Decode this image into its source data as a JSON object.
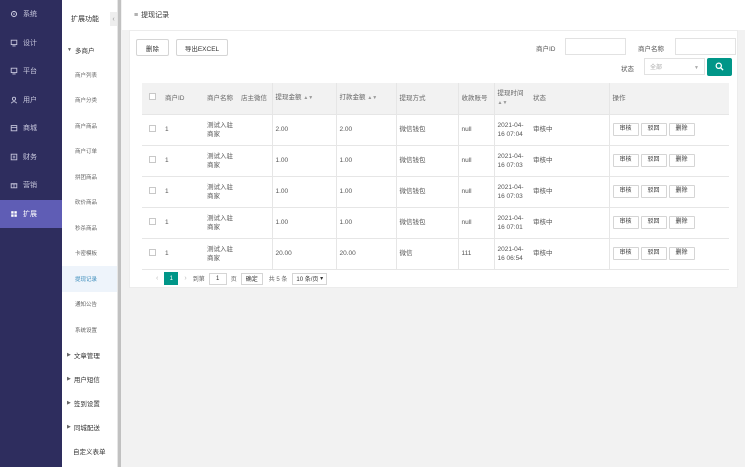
{
  "nav1": {
    "items": [
      {
        "label": "系统",
        "icon": "gear-icon"
      },
      {
        "label": "设计",
        "icon": "monitor-icon"
      },
      {
        "label": "平台",
        "icon": "monitor-icon"
      },
      {
        "label": "用户",
        "icon": "user-icon"
      },
      {
        "label": "商城",
        "icon": "store-icon"
      },
      {
        "label": "财务",
        "icon": "finance-icon"
      },
      {
        "label": "营销",
        "icon": "gift-icon"
      },
      {
        "label": "扩展",
        "icon": "grid-icon"
      }
    ],
    "active_index": 7,
    "active_color": "#5f5db5",
    "bg_color": "#2e2d5e"
  },
  "nav2": {
    "header": "扩展功能",
    "group_multi": "多商户",
    "sub_items": [
      "商户列表",
      "商户分类",
      "商户商品",
      "商户订单",
      "拼团商品",
      "砍价商品",
      "秒杀商品",
      "卡密模板",
      "提现记录",
      "通知公告",
      "系统设置"
    ],
    "active_sub": "提现记录",
    "groups_after": [
      "文章管理",
      "用户短信",
      "签到设置",
      "同城配送"
    ],
    "last_item": "自定义表单"
  },
  "tab": {
    "title": "提现记录"
  },
  "toolbar": {
    "delete_label": "删除",
    "export_label": "导出EXCEL",
    "merchant_id_label": "商户ID",
    "merchant_name_label": "商户名称",
    "status_label": "状态",
    "status_value": "全部",
    "accent": "#009688"
  },
  "table": {
    "headers": [
      "商户ID",
      "商户名称",
      "店主微信",
      "提现金额",
      "打款金额",
      "提现方式",
      "收款账号",
      "提现时间",
      "状态",
      "操作"
    ],
    "rows": [
      {
        "id": "1",
        "name": "测试入驻商家",
        "wx": "",
        "amount": "2.00",
        "paid": "2.00",
        "method": "微信钱包",
        "account": "null",
        "time": "2021-04-16 07:04",
        "status": "审核中"
      },
      {
        "id": "1",
        "name": "测试入驻商家",
        "wx": "",
        "amount": "1.00",
        "paid": "1.00",
        "method": "微信钱包",
        "account": "null",
        "time": "2021-04-16 07:03",
        "status": "审核中"
      },
      {
        "id": "1",
        "name": "测试入驻商家",
        "wx": "",
        "amount": "1.00",
        "paid": "1.00",
        "method": "微信钱包",
        "account": "null",
        "time": "2021-04-16 07:03",
        "status": "审核中"
      },
      {
        "id": "1",
        "name": "测试入驻商家",
        "wx": "",
        "amount": "1.00",
        "paid": "1.00",
        "method": "微信钱包",
        "account": "null",
        "time": "2021-04-16 07:01",
        "status": "审核中"
      },
      {
        "id": "1",
        "name": "测试入驻商家",
        "wx": "",
        "amount": "20.00",
        "paid": "20.00",
        "method": "微信",
        "account": "111",
        "time": "2021-04-16 06:54",
        "status": "审核中"
      }
    ],
    "ops": {
      "approve": "审核",
      "reject": "驳回",
      "delete": "删除"
    }
  },
  "pager": {
    "current": "1",
    "goto_label": "到第",
    "goto_value": "1",
    "page_unit": "页",
    "confirm_label": "确定",
    "total_label": "共 5 条",
    "per_page": "10 条/页"
  }
}
